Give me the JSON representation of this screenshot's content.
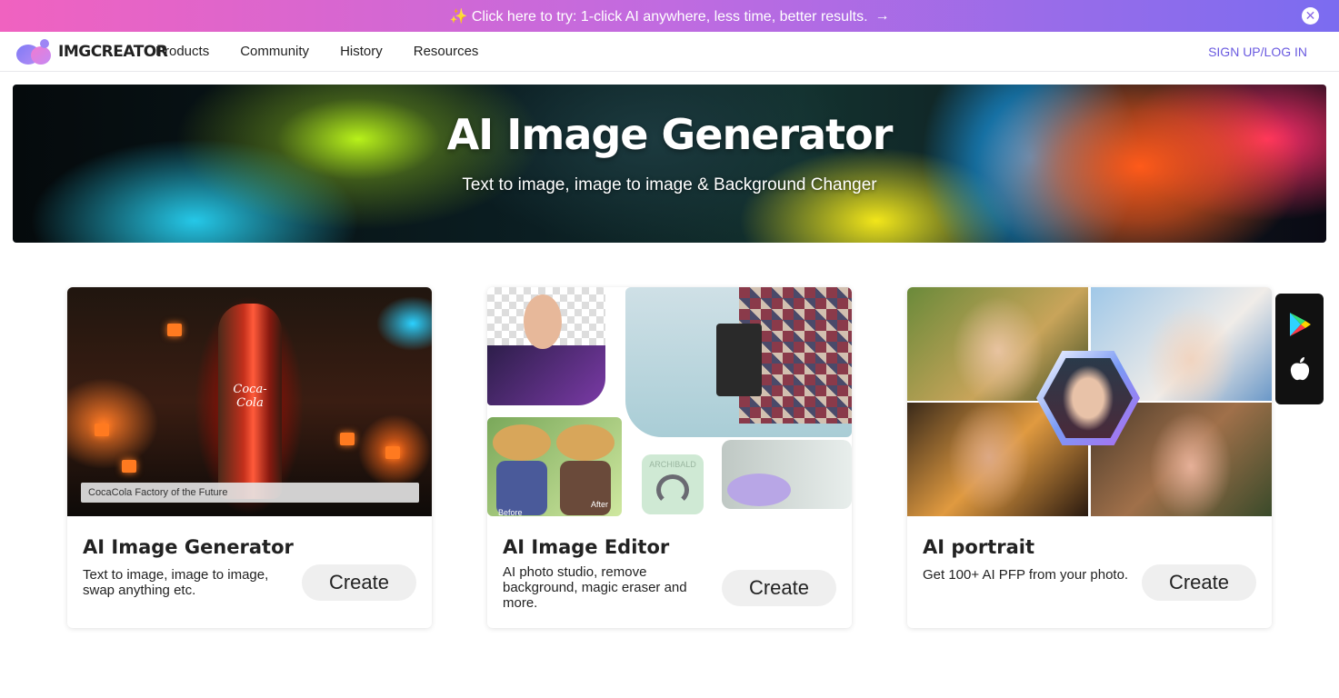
{
  "promo": {
    "text": "✨ Click here to try: 1-click AI anywhere, less time, better results.",
    "arrow": "→",
    "close": "✕"
  },
  "nav": {
    "logo_text": "IMGCREATOR",
    "items": [
      "Products",
      "Community",
      "History",
      "Resources"
    ],
    "signup": "SIGN UP/LOG IN"
  },
  "hero": {
    "title": "AI Image Generator",
    "subtitle": "Text to image, image to image & Background Changer"
  },
  "cards": [
    {
      "title": "AI Image Generator",
      "desc": "Text to image, image to image, swap anything etc.",
      "button": "Create",
      "image_caption": "CocaCola Factory of the Future",
      "bottle_label": "Coca-Cola"
    },
    {
      "title": "AI Image Editor",
      "desc": "AI photo studio, remove background, magic eraser and more.",
      "button": "Create",
      "label_before": "Before",
      "label_after": "After",
      "product_text": "ARCHIBALD"
    },
    {
      "title": "AI portrait",
      "desc": "Get 100+ AI PFP from your photo.",
      "button": "Create"
    }
  ],
  "icons": {
    "close": "close-icon",
    "arrow": "arrow-right-icon",
    "logo": "imgcreator-logo-icon",
    "google_play": "google-play-icon",
    "apple": "apple-icon"
  },
  "colors": {
    "accent": "#6a5ae0",
    "promo_start": "#f062c0",
    "promo_end": "#7b6cf0"
  }
}
